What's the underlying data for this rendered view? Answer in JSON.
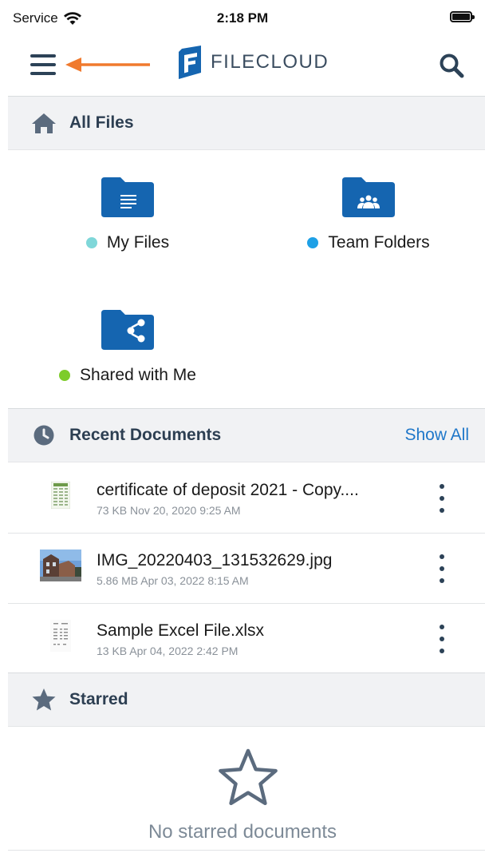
{
  "status_bar": {
    "carrier": "Service",
    "time": "2:18 PM"
  },
  "app_bar": {
    "logo_text": "FILECLOUD",
    "icons": [
      "menu-icon",
      "search-icon",
      "filecloud-logo-icon"
    ],
    "annotation_arrow_color": "#f07a2e"
  },
  "all_files": {
    "title": "All Files",
    "folders": [
      {
        "label": "My Files",
        "dot_color": "#7fd7d9",
        "icon": "document-folder-icon"
      },
      {
        "label": "Team Folders",
        "dot_color": "#1ea0e6",
        "icon": "team-folder-icon"
      },
      {
        "label": "Shared with Me",
        "dot_color": "#7dcc2a",
        "icon": "shared-folder-icon"
      }
    ]
  },
  "recent": {
    "title": "Recent Documents",
    "show_all": "Show All",
    "documents": [
      {
        "name": "certificate of deposit 2021 - Copy....",
        "meta": "73 KB Nov 20, 2020 9:25 AM",
        "thumb": "spreadsheet-thumbnail"
      },
      {
        "name": "IMG_20220403_131532629.jpg",
        "meta": "5.86 MB Apr 03, 2022 8:15 AM",
        "thumb": "photo-thumbnail"
      },
      {
        "name": "Sample Excel File.xlsx",
        "meta": "13 KB Apr 04, 2022 2:42 PM",
        "thumb": "excel-thumbnail"
      }
    ]
  },
  "starred": {
    "title": "Starred",
    "empty_text": "No starred documents"
  },
  "colors": {
    "brand_blue": "#1565b0",
    "link_blue": "#1f77c9",
    "header_bg": "#f1f2f4",
    "icon_gray": "#5b6b7e"
  }
}
